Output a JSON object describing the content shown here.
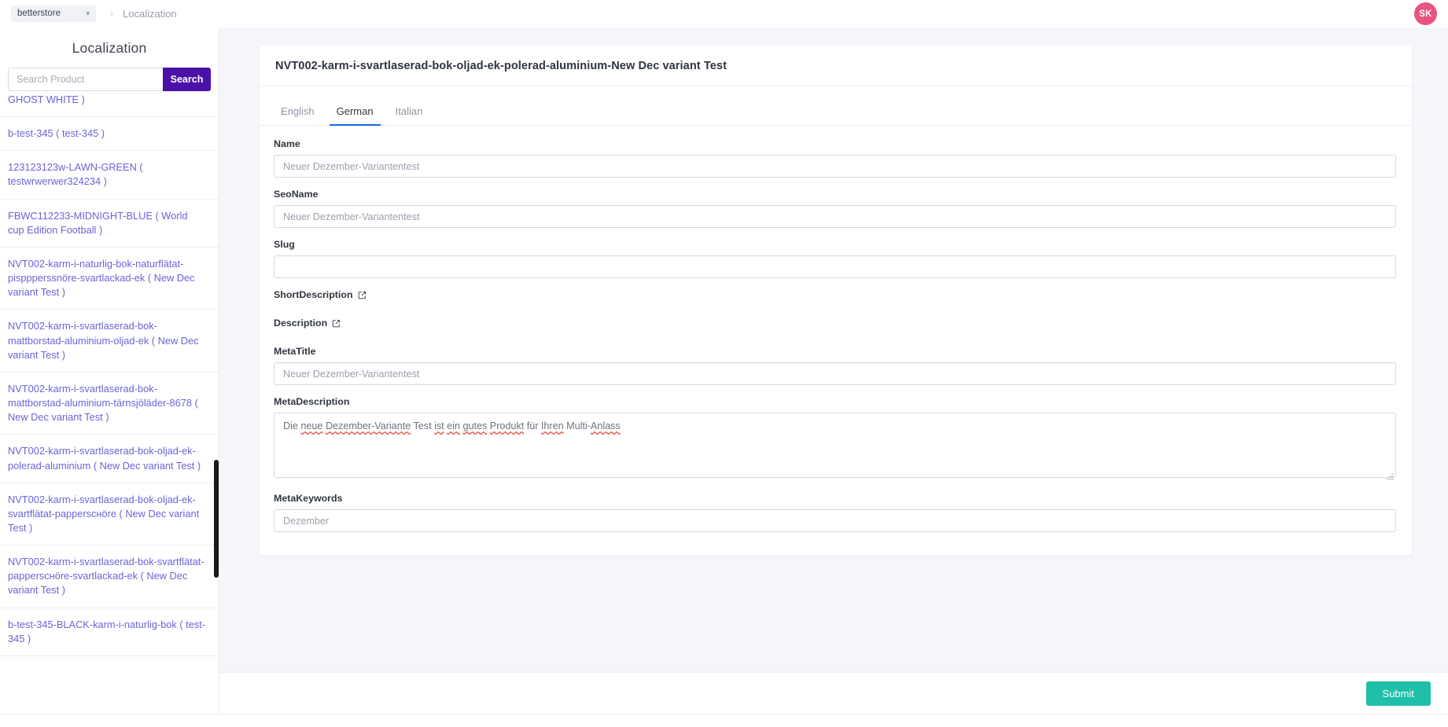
{
  "topbar": {
    "store_name": "betterstore",
    "chevron_icon": "chevron-down-icon",
    "breadcrumb_separator": "›",
    "breadcrumb_current": "Localization",
    "avatar_initials": "SK",
    "avatar_color": "#e8537f"
  },
  "sidebar": {
    "title": "Localization",
    "search": {
      "placeholder": "Search Product",
      "value": "",
      "button_label": "Search",
      "button_color": "#4b10a8"
    },
    "products": [
      {
        "sku": "",
        "name": "GHOST WHITE )",
        "partial_top": true
      },
      {
        "sku": "b-test-345",
        "name": "( test-345 )"
      },
      {
        "sku": "123123123w-LAWN-GREEN",
        "name": "( testwrwerwer324234 )"
      },
      {
        "sku": "FBWC112233-MIDNIGHT-BLUE",
        "name": "( World cup Edition Football )"
      },
      {
        "sku": "NVT002-karm-i-naturlig-bok-naturflätat-pisppperssnöre-svartlackad-ek",
        "name": "( New Dec variant Test )"
      },
      {
        "sku": "NVT002-karm-i-svartlaserad-bok-mattborstad-aluminium-oljad-ek",
        "name": "( New Dec variant Test )"
      },
      {
        "sku": "NVT002-karm-i-svartlaserad-bok-mattborstad-aluminium-tärnsjöläder-8678",
        "name": "( New Dec variant Test )"
      },
      {
        "sku": "NVT002-karm-i-svartlaserad-bok-oljad-ek-polerad-aluminium",
        "name": "( New Dec variant Test )"
      },
      {
        "sku": "NVT002-karm-i-svartlaserad-bok-oljad-ek-svartflätat-pappersснöre",
        "name": "( New Dec variant Test )"
      },
      {
        "sku": "NVT002-karm-i-svartlaserad-bok-svartflätat-pappersснöre-svartlackad-ek",
        "name": "( New Dec variant Test )"
      },
      {
        "sku": "b-test-345-BLACK-karm-i-naturlig-bok",
        "name": "( test-345 )"
      }
    ],
    "products_text": [
      "GHOST WHITE )",
      "b-test-345 ( test-345 )",
      "123123123w-LAWN-GREEN ( testwrwerwer324234 )",
      "FBWC112233-MIDNIGHT-BLUE ( World cup Edition Football )",
      "NVT002-karm-i-naturlig-bok-naturflätat-pisppperssnöre-svartlackad-ek ( New Dec variant Test )",
      "NVT002-karm-i-svartlaserad-bok-mattborstad-aluminium-oljad-ek ( New Dec variant Test )",
      "NVT002-karm-i-svartlaserad-bok-mattborstad-aluminium-tärnsjöläder-8678 ( New Dec variant Test )",
      "NVT002-karm-i-svartlaserad-bok-oljad-ek-polerad-aluminium ( New Dec variant Test )",
      "NVT002-karm-i-svartlaserad-bok-oljad-ek-svartflätat-pappersснöre ( New Dec variant Test )",
      "NVT002-karm-i-svartlaserad-bok-svartflätat-pappersснöre-svartlackad-ek ( New Dec variant Test )",
      "b-test-345-BLACK-karm-i-naturlig-bok ( test-345 )"
    ]
  },
  "main": {
    "card_title": "NVT002-karm-i-svartlaserad-bok-oljad-ek-polerad-aluminium-New Dec variant Test",
    "tabs": [
      {
        "label": "English",
        "active": false
      },
      {
        "label": "German",
        "active": true
      },
      {
        "label": "Italian",
        "active": false
      }
    ],
    "active_tab_color": "#1b6ae0",
    "fields": {
      "name": {
        "label": "Name",
        "placeholder": "Neuer Dezember-Variantentest",
        "value": ""
      },
      "seoname": {
        "label": "SeoName",
        "placeholder": "Neuer Dezember-Variantentest",
        "value": ""
      },
      "slug": {
        "label": "Slug",
        "placeholder": "",
        "value": ""
      },
      "shortdescription": {
        "label": "ShortDescription",
        "edit_icon": "edit-square-icon"
      },
      "description": {
        "label": "Description",
        "edit_icon": "edit-square-icon"
      },
      "metatitle": {
        "label": "MetaTitle",
        "placeholder": "Neuer Dezember-Variantentest",
        "value": ""
      },
      "metadescription": {
        "label": "MetaDescription",
        "value": "Die neue Dezember-Variante Test ist ein gutes Produkt für Ihren Multi-Anlass",
        "tokens": [
          {
            "t": "Die ",
            "m": false
          },
          {
            "t": "neue",
            "m": true
          },
          {
            "t": " ",
            "m": false
          },
          {
            "t": "Dezember-Variante",
            "m": true
          },
          {
            "t": " Test ",
            "m": false
          },
          {
            "t": "ist",
            "m": true
          },
          {
            "t": " ",
            "m": false
          },
          {
            "t": "ein",
            "m": true
          },
          {
            "t": " ",
            "m": false
          },
          {
            "t": "gutes",
            "m": true
          },
          {
            "t": " ",
            "m": false
          },
          {
            "t": "Produkt",
            "m": true
          },
          {
            "t": " für ",
            "m": false
          },
          {
            "t": "Ihren",
            "m": true
          },
          {
            "t": " Multi-",
            "m": false
          },
          {
            "t": "Anlass",
            "m": true
          }
        ],
        "spellcheck_underline_color": "#e8443a"
      },
      "metakeywords": {
        "label": "MetaKeywords",
        "placeholder": "Dezember",
        "value": ""
      }
    }
  },
  "footer": {
    "submit_label": "Submit",
    "submit_color": "#20bfa9"
  }
}
